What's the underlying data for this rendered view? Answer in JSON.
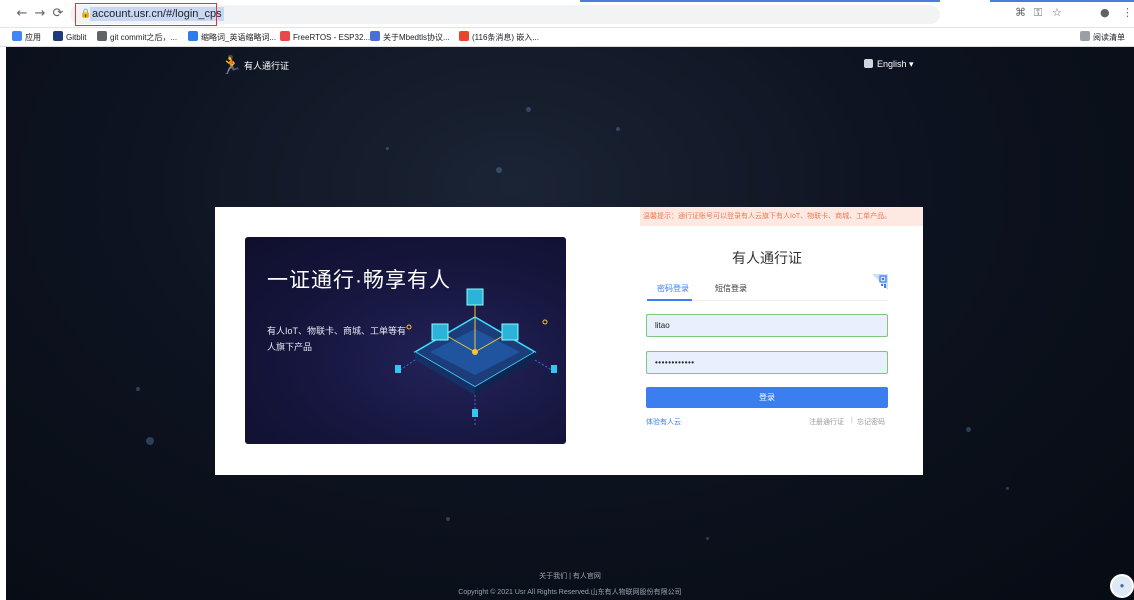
{
  "browser": {
    "url": "account.usr.cn/#/login_cps",
    "bookmarks": [
      {
        "label": "应用",
        "color": "#4285f4"
      },
      {
        "label": "Gitblit",
        "color": "#1d3a7a"
      },
      {
        "label": "git commit之后，...",
        "color": "#5f6368"
      },
      {
        "label": "缩略词_英语缩略词...",
        "color": "#2b7de9"
      },
      {
        "label": "FreeRTOS - ESP32...",
        "color": "#e84a4a"
      },
      {
        "label": "关于Mbedtls协议...",
        "color": "#4a6fd8"
      },
      {
        "label": "(116条消息) 嵌入...",
        "color": "#e8452c"
      }
    ],
    "reading_list": "阅读清单"
  },
  "header": {
    "title": "有人通行证",
    "language": "English"
  },
  "banner": {
    "title": "一证通行·畅享有人",
    "subtitle": "有人IoT、物联卡、商城、工单等有人旗下产品"
  },
  "login": {
    "notice": "温馨提示：通行证账号可以登录有人云旗下有人IoT、物联卡、商城、工单产品。",
    "title": "有人通行证",
    "tabs": [
      "密码登录",
      "短信登录"
    ],
    "username": "litao",
    "password": "••••••••••••",
    "submit": "登录",
    "experience_link": "体验有人云",
    "register_link": "注册通行证",
    "separator": "|",
    "forgot_link": "忘记密码"
  },
  "footer": {
    "links": "关于我们 | 有人官网",
    "copyright": "Copyright © 2021 Usr All Rights Reserved.山东有人物联网股份有限公司"
  },
  "colors": {
    "accent": "#3a7ef0",
    "notice_bg": "#fde9e2",
    "notice_text": "#ee7b55"
  }
}
